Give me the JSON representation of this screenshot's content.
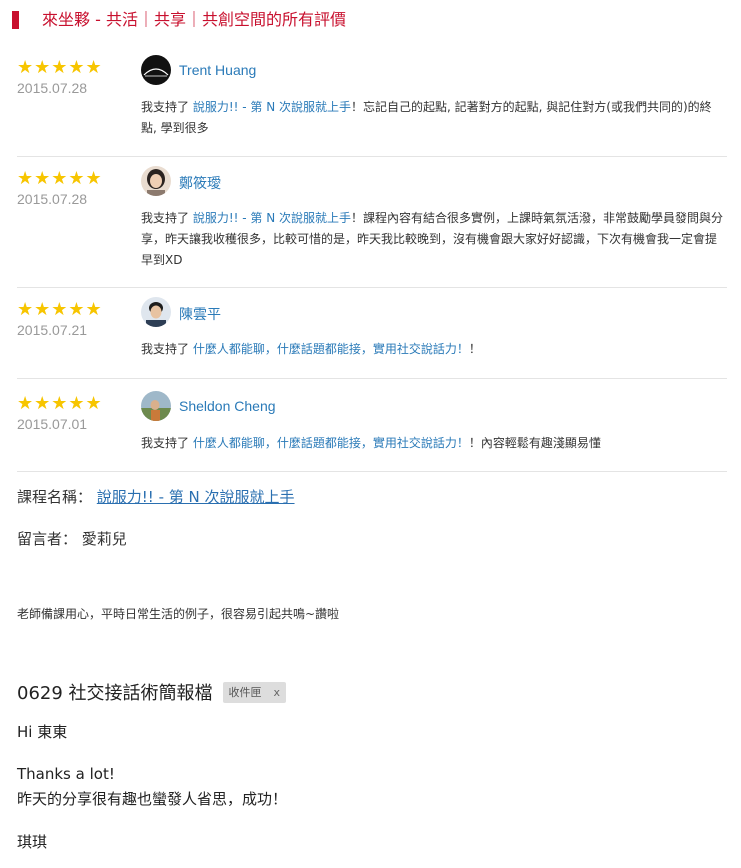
{
  "header": {
    "title": "來坐夥 - 共活｜共享｜共創空間的所有評價",
    "accent_color": "#c8102e"
  },
  "reviews": [
    {
      "stars": "★★★★★",
      "rating": 5,
      "date": "2015.07.28",
      "reviewer": "Trent Huang",
      "prefix": "我支持了",
      "course_link": "說服力!! - 第 N 次說服就上手",
      "suffix": "！忘記自己的起點, 記著對方的起點, 與記住對方(或我們共同的)的終點, 學到很多"
    },
    {
      "stars": "★★★★★",
      "rating": 5,
      "date": "2015.07.28",
      "reviewer": "鄭筱璦",
      "prefix": "我支持了",
      "course_link": "說服力!! - 第 N 次說服就上手",
      "suffix": "！課程內容有結合很多實例，上課時氣氛活潑，非常鼓勵學員發問與分享，昨天讓我收穫很多，比較可惜的是，昨天我比較晚到，沒有機會跟大家好好認識，下次有機會我一定會提早到XD"
    },
    {
      "stars": "★★★★★",
      "rating": 5,
      "date": "2015.07.21",
      "reviewer": "陳雲平",
      "prefix": "我支持了",
      "course_link": "什麼人都能聊，什麼話題都能接，實用社交說話力！",
      "suffix": "！"
    },
    {
      "stars": "★★★★★",
      "rating": 5,
      "date": "2015.07.01",
      "reviewer": "Sheldon Cheng",
      "prefix": "我支持了",
      "course_link": "什麼人都能聊，什麼話題都能接，實用社交說話力！",
      "suffix": "！內容輕鬆有趣淺顯易懂"
    }
  ],
  "course": {
    "label": "課程名稱：",
    "name": "說服力!! - 第 N 次說服就上手"
  },
  "commenter": {
    "label": "留言者：",
    "name": "愛莉兒"
  },
  "feedback": "老師備課用心，平時日常生活的例子，很容易引起共鳴~讚啦",
  "email": {
    "subject": "0629 社交接話術簡報檔",
    "tag": "收件匣",
    "tag_close": "x",
    "greeting": "Hi 東東",
    "thanks": "Thanks a lot!",
    "body": "昨天的分享很有趣也蠻發人省思，成功！",
    "signature": "琪琪"
  }
}
